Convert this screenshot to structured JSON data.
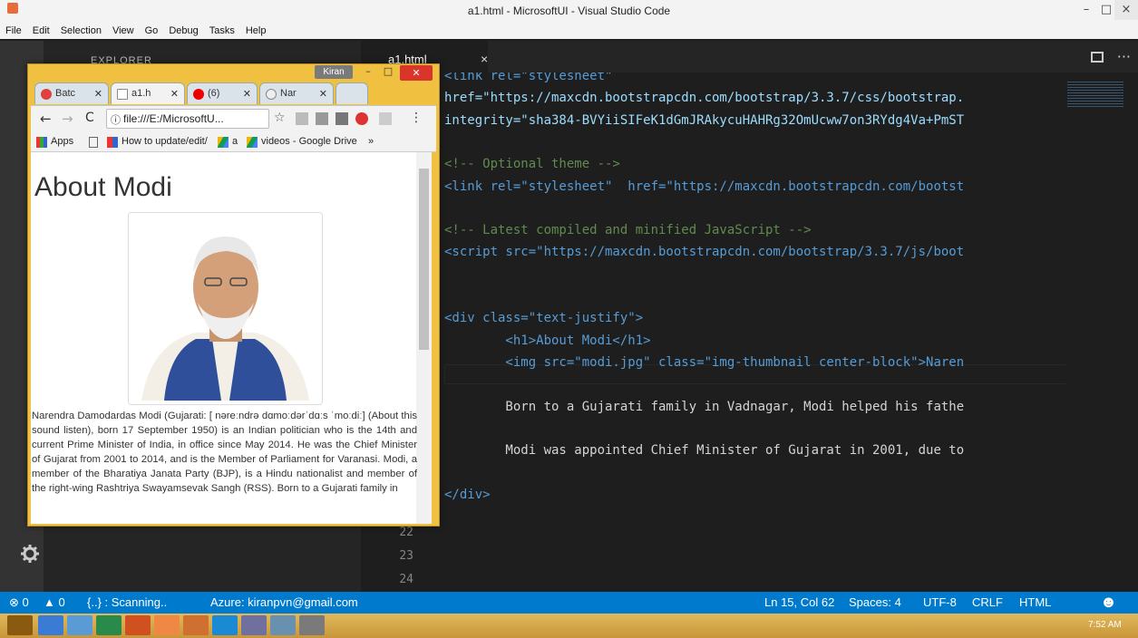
{
  "window": {
    "title": "a1.html - MicrosoftUI - Visual Studio Code",
    "min": "–",
    "max": "□",
    "close": "×"
  },
  "menu": [
    "File",
    "Edit",
    "Selection",
    "View",
    "Go",
    "Debug",
    "Tasks",
    "Help"
  ],
  "sidebar": {
    "header": "EXPLORER"
  },
  "editor": {
    "tab": {
      "label": "a1.html",
      "close": "×"
    },
    "code": [
      {
        "t": "<link rel=\"stylesheet\"",
        "cls": "tg"
      },
      {
        "t": "href=\"https://maxcdn.bootstrapcdn.com/bootstrap/3.3.7/css/bootstrap.",
        "cls": "at"
      },
      {
        "t": "integrity=\"sha384-BVYiiSIFeK1dGmJRAkycuHAHRg32OmUcww7on3RYdg4Va+PmST",
        "cls": "at"
      },
      {
        "t": "",
        "cls": ""
      },
      {
        "t": "<!-- Optional theme -->",
        "cls": "cm"
      },
      {
        "t": "<link rel=\"stylesheet\"  href=\"https://maxcdn.bootstrapcdn.com/bootst",
        "cls": "tg"
      },
      {
        "t": "",
        "cls": ""
      },
      {
        "t": "<!-- Latest compiled and minified JavaScript -->",
        "cls": "cm"
      },
      {
        "t": "<script src=\"https://maxcdn.bootstrapcdn.com/bootstrap/3.3.7/js/boot",
        "cls": "tg"
      },
      {
        "t": "",
        "cls": ""
      },
      {
        "t": "",
        "cls": ""
      },
      {
        "t": "<div class=\"text-justify\">",
        "cls": "tg"
      },
      {
        "t": "        <h1>About Modi</h1>",
        "cls": "tg"
      },
      {
        "t": "        <img src=\"modi.jpg\" class=\"img-thumbnail center-block\">Naren",
        "cls": "tg"
      },
      {
        "t": "",
        "cls": ""
      },
      {
        "t": "        Born to a Gujarati family in Vadnagar, Modi helped his fathe",
        "cls": ""
      },
      {
        "t": "",
        "cls": ""
      },
      {
        "t": "        Modi was appointed Chief Minister of Gujarat in 2001, due to",
        "cls": ""
      },
      {
        "t": "",
        "cls": ""
      },
      {
        "t": "</div>",
        "cls": "tg"
      }
    ],
    "line_numbers": [
      "22",
      "23",
      "24"
    ]
  },
  "status": {
    "errors": "⊗ 0",
    "warnings": "▲ 0",
    "scan": "{..} : Scanning..",
    "azure": "Azure: kiranpvn@gmail.com",
    "position": "Ln 15, Col 62",
    "spaces": "Spaces: 4",
    "encoding": "UTF-8",
    "eol": "CRLF",
    "language": "HTML",
    "smiley": "☻"
  },
  "taskbar": {
    "time": "7:52 AM"
  },
  "chrome": {
    "profile": "Kiran",
    "tabs": [
      "Batc",
      "a1.h",
      "(6)",
      "Nar"
    ],
    "address": "file:///E:/MicrosoftU...",
    "bookmarks": [
      "Apps",
      "How to update/edit/",
      "a",
      "videos - Google Drive",
      "»"
    ],
    "page": {
      "heading": "About Modi",
      "paragraph": "Narendra Damodardas Modi (Gujarati: [ nəreːndrə dɑmoːdərˈdɑːs ˈmoːdiː] (About this sound listen), born 17 September 1950) is an Indian politician who is the 14th and current Prime Minister of India, in office since May 2014. He was the Chief Minister of Gujarat from 2001 to 2014, and is the Member of Parliament for Varanasi. Modi, a member of the Bharatiya Janata Party (BJP), is a Hindu nationalist and member of the right-wing Rashtriya Swayamsevak Sangh (RSS). Born to a Gujarati family in"
    }
  }
}
